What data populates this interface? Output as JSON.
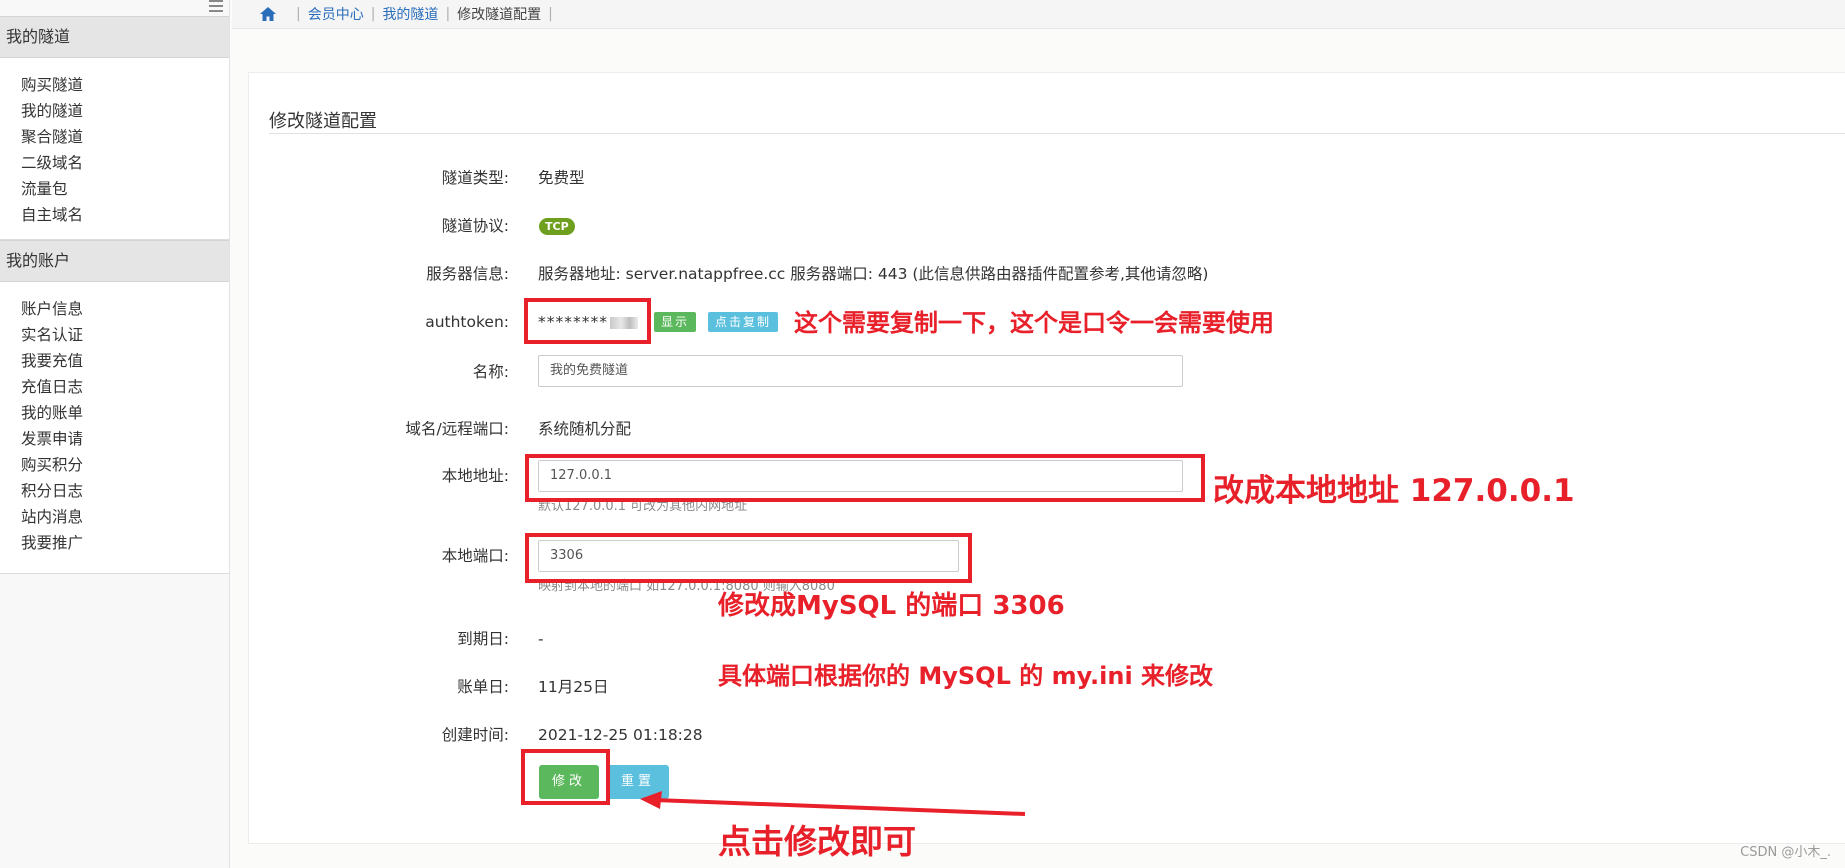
{
  "sidebar": {
    "section1": {
      "title": "我的隧道",
      "items": [
        "购买隧道",
        "我的隧道",
        "聚合隧道",
        "二级域名",
        "流量包",
        "自主域名"
      ]
    },
    "section2": {
      "title": "我的账户",
      "items": [
        "账户信息",
        "实名认证",
        "我要充值",
        "充值日志",
        "我的账单",
        "发票申请",
        "购买积分",
        "积分日志",
        "站内消息",
        "我要推广"
      ]
    }
  },
  "breadcrumb": {
    "items": [
      "会员中心",
      "我的隧道"
    ],
    "current": "修改隧道配置"
  },
  "form": {
    "title": "修改隧道配置",
    "tunnel_type": {
      "label": "隧道类型:",
      "value": "免费型"
    },
    "protocol": {
      "label": "隧道协议:",
      "badge": "TCP"
    },
    "server_info": {
      "label": "服务器信息:",
      "value": "服务器地址: server.natappfree.cc 服务器端口: 443 (此信息供路由器插件配置参考,其他请忽略)"
    },
    "authtoken": {
      "label": "authtoken:",
      "masked": "********",
      "show_label": "显示",
      "copy_label": "点击复制"
    },
    "name": {
      "label": "名称:",
      "value": "我的免费隧道"
    },
    "domain_port": {
      "label": "域名/远程端口:",
      "value": "系统随机分配"
    },
    "local_address": {
      "label": "本地地址:",
      "value": "127.0.0.1",
      "help": "默认127.0.0.1 可改为其他内网地址"
    },
    "local_port": {
      "label": "本地端口:",
      "value": "3306",
      "help": "映射到本地的端口 如127.0.0.1:8080 则输入8080"
    },
    "expire_date": {
      "label": "到期日:",
      "value": "-"
    },
    "billing_date": {
      "label": "账单日:",
      "value": "11月25日"
    },
    "created_time": {
      "label": "创建时间:",
      "value": "2021-12-25 01:18:28"
    },
    "submit_label": "修改",
    "reset_label": "重置"
  },
  "annotations": {
    "authtoken_note": "这个需要复制一下，这个是口令一会需要使用",
    "address_note": "改成本地地址 127.0.0.1",
    "port_note": "修改成MySQL 的端口  3306",
    "port_note2": "具体端口根据你的 MySQL 的 my.ini 来修改",
    "click_note": "点击修改即可",
    "color": "#e8202a"
  },
  "watermark": "CSDN @小木_."
}
